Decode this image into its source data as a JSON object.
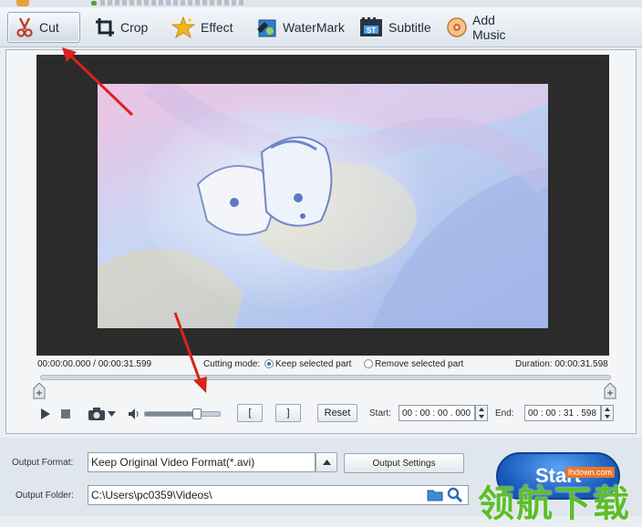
{
  "toolbar": {
    "items": [
      {
        "label": "Cut",
        "icon": "scissors-icon"
      },
      {
        "label": "Crop",
        "icon": "crop-icon"
      },
      {
        "label": "Effect",
        "icon": "effect-star-icon"
      },
      {
        "label": "WaterMark",
        "icon": "watermark-icon"
      },
      {
        "label": "Subtitle",
        "icon": "subtitle-icon"
      },
      {
        "label": "Add Music",
        "icon": "music-icon"
      }
    ],
    "active": "Cut"
  },
  "timeline": {
    "position": "00:00:00.000 / 00:00:31.599",
    "cutting_mode_label": "Cutting mode:",
    "keep_label": "Keep selected part",
    "remove_label": "Remove selected part",
    "selected_mode": "keep",
    "duration": "Duration: 00:00:31.598"
  },
  "controls": {
    "reset_label": "Reset",
    "start_label": "Start:",
    "start_value": "00 : 00 : 00 . 000",
    "end_label": "End:",
    "end_value": "00 : 00 : 31 . 598",
    "volume_level": 0.7,
    "mark_in_label": "[",
    "mark_out_label": "]"
  },
  "output": {
    "format_label": "Output Format:",
    "format_value": "Keep Original Video Format(*.avi)",
    "settings_label": "Output Settings",
    "folder_label": "Output Folder:",
    "folder_value": "C:\\Users\\pc0359\\Videos\\",
    "start_label": "Start"
  },
  "watermark": {
    "text": "领航下载",
    "site": "lhdown.com"
  },
  "colors": {
    "accent": "#1656b8",
    "arrow": "#d9231b",
    "panel": "#f3f5f7"
  }
}
